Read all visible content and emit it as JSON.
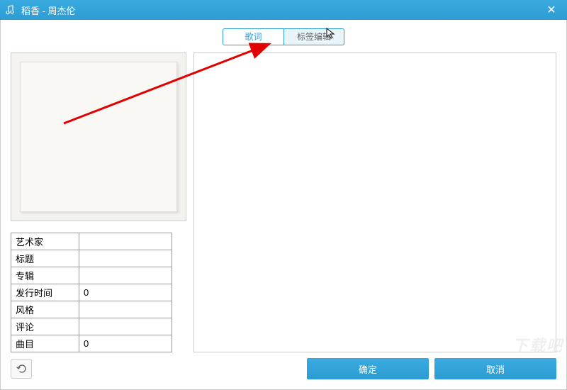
{
  "titlebar": {
    "title": "稻香 - 周杰伦"
  },
  "tabs": {
    "lyrics": "歌词",
    "tag_edit": "标签编辑"
  },
  "meta": {
    "artist_label": "艺术家",
    "artist_value": "",
    "title_label": "标题",
    "title_value": "",
    "album_label": "专辑",
    "album_value": "",
    "release_label": "发行时间",
    "release_value": "0",
    "genre_label": "风格",
    "genre_value": "",
    "comment_label": "评论",
    "comment_value": "",
    "track_label": "曲目",
    "track_value": "0"
  },
  "buttons": {
    "ok": "确定",
    "cancel": "取消"
  },
  "watermark": "下载吧"
}
